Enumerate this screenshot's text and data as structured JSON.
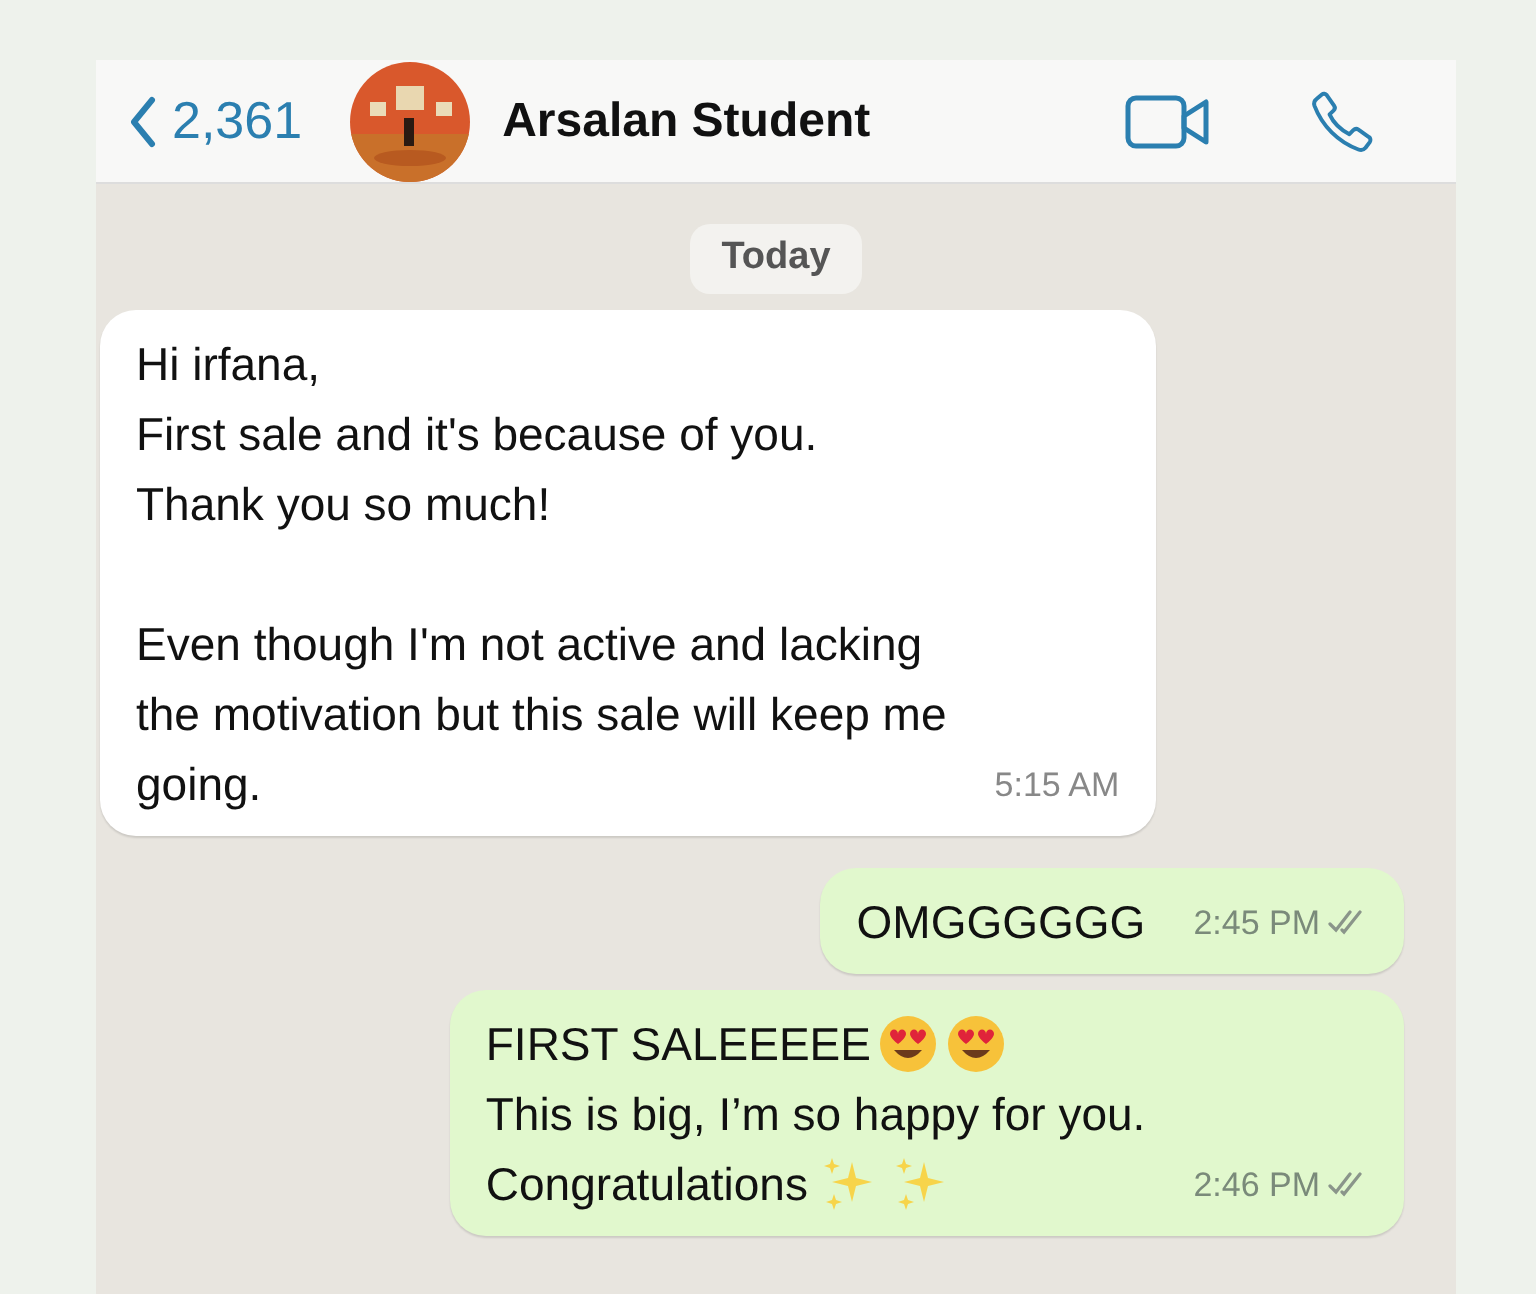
{
  "header": {
    "back_count": "2,361",
    "contact_name": "Arsalan Student"
  },
  "date_chip": "Today",
  "messages": [
    {
      "kind": "incoming",
      "paragraphs": [
        [
          [
            {
              "kind": "text",
              "text": "Hi irfana,"
            }
          ],
          [
            {
              "kind": "text",
              "text": "First sale and it's because of you."
            }
          ],
          [
            {
              "kind": "text",
              "text": "Thank you so much!"
            }
          ]
        ],
        [
          [
            {
              "kind": "text",
              "text": "Even though I'm not active and lacking"
            }
          ],
          [
            {
              "kind": "text",
              "text": "the motivation but this sale will keep me"
            }
          ],
          [
            {
              "kind": "text",
              "text": "going."
            }
          ]
        ]
      ],
      "time": "5:15 AM"
    },
    {
      "kind": "outgoing",
      "paragraphs": [
        [
          [
            {
              "kind": "text",
              "text": "OMGGGGGG"
            }
          ]
        ]
      ],
      "time": "2:45 PM",
      "read": false
    },
    {
      "kind": "outgoing",
      "paragraphs": [
        [
          [
            {
              "kind": "text",
              "text": "FIRST SALEEEEE"
            },
            {
              "kind": "love-face"
            },
            {
              "kind": "love-face"
            }
          ],
          [
            {
              "kind": "text",
              "text": "This is big, I’m so happy for you."
            }
          ],
          [
            {
              "kind": "text",
              "text": "Congratulations"
            },
            {
              "kind": "sparkles"
            },
            {
              "kind": "sparkles"
            }
          ]
        ]
      ],
      "time": "2:46 PM",
      "read": false
    }
  ]
}
